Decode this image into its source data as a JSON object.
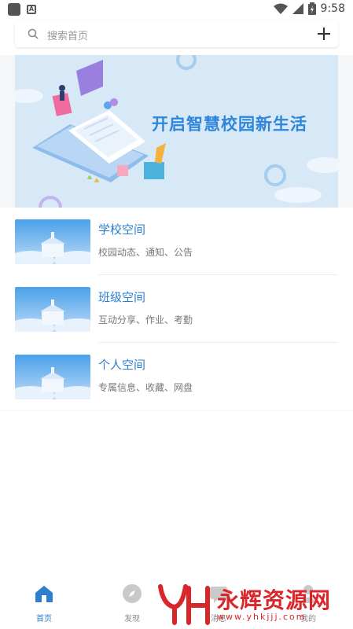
{
  "status_bar": {
    "time": "9:58"
  },
  "search": {
    "placeholder": "搜索首页"
  },
  "banner": {
    "text": "开启智慧校园新生活"
  },
  "list": [
    {
      "title": "学校空间",
      "subtitle": "校园动态、通知、公告"
    },
    {
      "title": "班级空间",
      "subtitle": "互动分享、作业、考勤"
    },
    {
      "title": "个人空间",
      "subtitle": "专属信息、收藏、网盘"
    }
  ],
  "tabs": [
    {
      "label": "首页",
      "icon": "home-icon",
      "active": true
    },
    {
      "label": "发现",
      "icon": "compass-icon",
      "active": false
    },
    {
      "label": "消息",
      "icon": "message-icon",
      "active": false
    },
    {
      "label": "我的",
      "icon": "user-icon",
      "active": false
    }
  ],
  "watermark": {
    "title": "永辉资源网",
    "url": "www.yhkjjj.com"
  },
  "colors": {
    "accent": "#2a7fd0",
    "banner_bg": "#d7e8f7",
    "page_bg": "#f5f6f8",
    "watermark": "#d8262b"
  }
}
